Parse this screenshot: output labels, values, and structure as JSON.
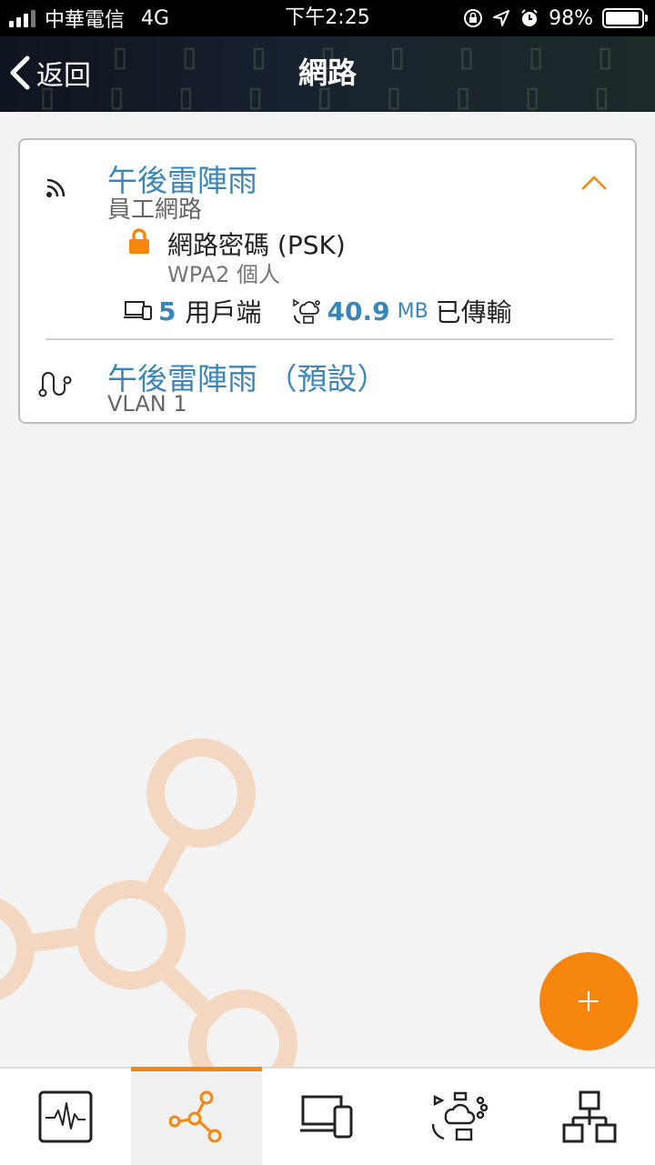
{
  "status_bar": {
    "carrier": "中華電信",
    "network": "4G",
    "time": "下午2:25",
    "battery": "98%"
  },
  "header": {
    "back_label": "返回",
    "title": "網路"
  },
  "network_card": {
    "ssid": {
      "name": "午後雷陣雨",
      "subtitle": "員工網路",
      "security_label": "網路密碼 (PSK)",
      "security_type": "WPA2 個人",
      "clients_count": "5",
      "clients_label": "用戶端",
      "transfer_value": "40.9",
      "transfer_unit": "MB",
      "transfer_label": "已傳輸"
    },
    "vlan": {
      "name": "午後雷陣雨 （預設）",
      "subtitle": "VLAN 1"
    }
  },
  "tabs": [
    {
      "name": "monitor",
      "icon": "activity-monitor-icon"
    },
    {
      "name": "networks",
      "icon": "network-nodes-icon",
      "active": true
    },
    {
      "name": "devices",
      "icon": "devices-icon"
    },
    {
      "name": "clients",
      "icon": "cloud-services-icon"
    },
    {
      "name": "topology",
      "icon": "topology-icon"
    }
  ],
  "colors": {
    "accent": "#f7860e",
    "link_blue": "#3b86b8",
    "deco": "#f4d7c1"
  }
}
